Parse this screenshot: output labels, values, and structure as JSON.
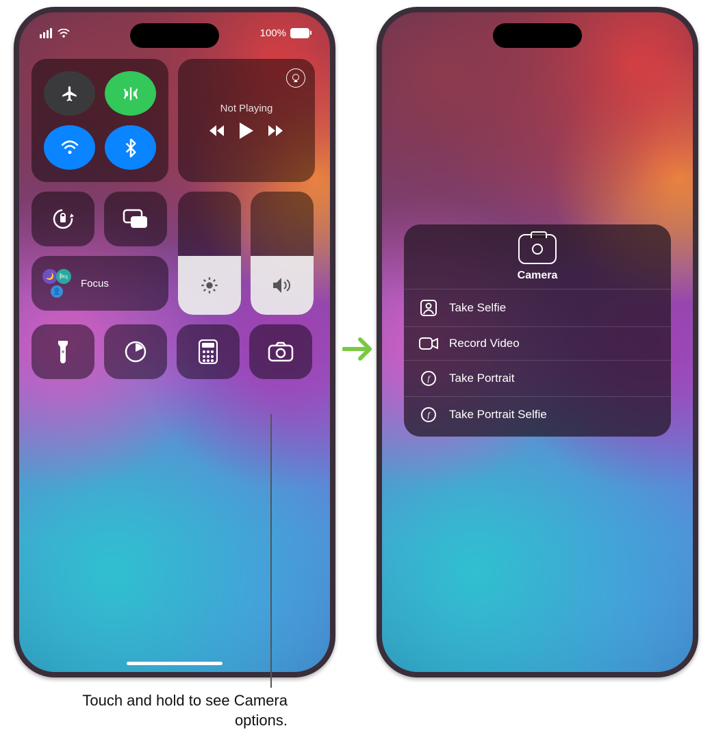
{
  "status": {
    "battery": "100%"
  },
  "music": {
    "status": "Not Playing"
  },
  "focus": {
    "label": "Focus"
  },
  "camera_menu": {
    "title": "Camera",
    "items": [
      {
        "label": "Take Selfie"
      },
      {
        "label": "Record Video"
      },
      {
        "label": "Take Portrait"
      },
      {
        "label": "Take Portrait Selfie"
      }
    ]
  },
  "caption": "Touch and hold to see Camera options.",
  "colors": {
    "cellular": "#34c759",
    "wifi": "#0a84ff",
    "bluetooth": "#0a84ff",
    "airplane": "#3a3a3c"
  }
}
